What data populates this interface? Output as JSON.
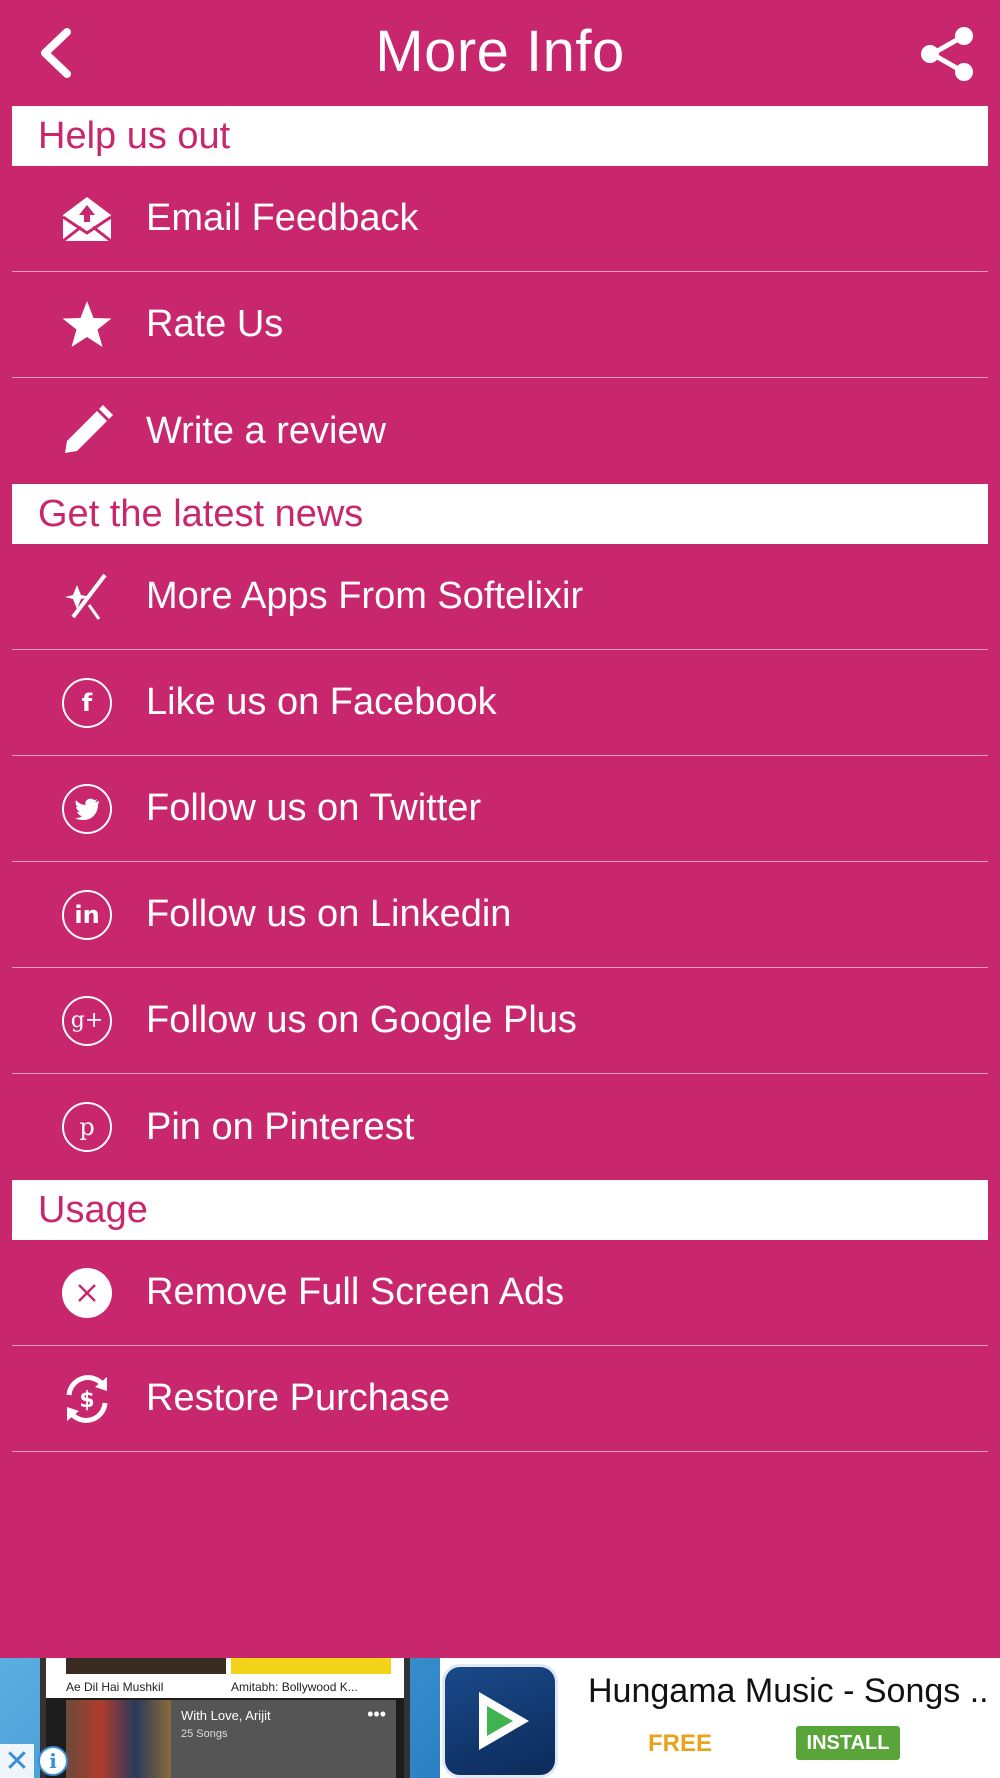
{
  "header": {
    "title": "More Info",
    "back_icon": "chevron-left-icon",
    "share_icon": "share-icon"
  },
  "sections": [
    {
      "title": "Help us out",
      "items": [
        {
          "label": "Email Feedback",
          "icon": "email-icon"
        },
        {
          "label": "Rate Us",
          "icon": "star-icon"
        },
        {
          "label": "Write a review",
          "icon": "pencil-icon"
        }
      ]
    },
    {
      "title": "Get the latest news",
      "items": [
        {
          "label": "More Apps From Softelixir",
          "icon": "sparkle-icon"
        },
        {
          "label": "Like us on Facebook",
          "icon": "facebook-icon",
          "glyph": "f"
        },
        {
          "label": "Follow us on Twitter",
          "icon": "twitter-icon"
        },
        {
          "label": "Follow us on Linkedin",
          "icon": "linkedin-icon",
          "glyph": "in"
        },
        {
          "label": "Follow us on Google Plus",
          "icon": "google-plus-icon",
          "glyph": "g+"
        },
        {
          "label": "Pin on Pinterest",
          "icon": "pinterest-icon",
          "glyph": "p"
        }
      ]
    },
    {
      "title": "Usage",
      "items": [
        {
          "label": "Remove Full Screen Ads",
          "icon": "close-circle-icon"
        },
        {
          "label": "Restore Purchase",
          "icon": "restore-purchase-icon"
        }
      ]
    }
  ],
  "ad": {
    "app_title": "Hungama Music - Songs ...",
    "price": "FREE",
    "install_label": "INSTALL",
    "screenshot": {
      "album1": "Ae Dil Hai Mushkil",
      "album2": "Amitabh: Bollywood K...",
      "playlist_title": "With Love, Arijit",
      "playlist_count": "25 Songs"
    }
  },
  "colors": {
    "background": "#c8266d",
    "section_header_bg": "#ffffff",
    "section_header_text": "#c8266d",
    "ad_free": "#e8a21c",
    "ad_install": "#5aa539"
  }
}
